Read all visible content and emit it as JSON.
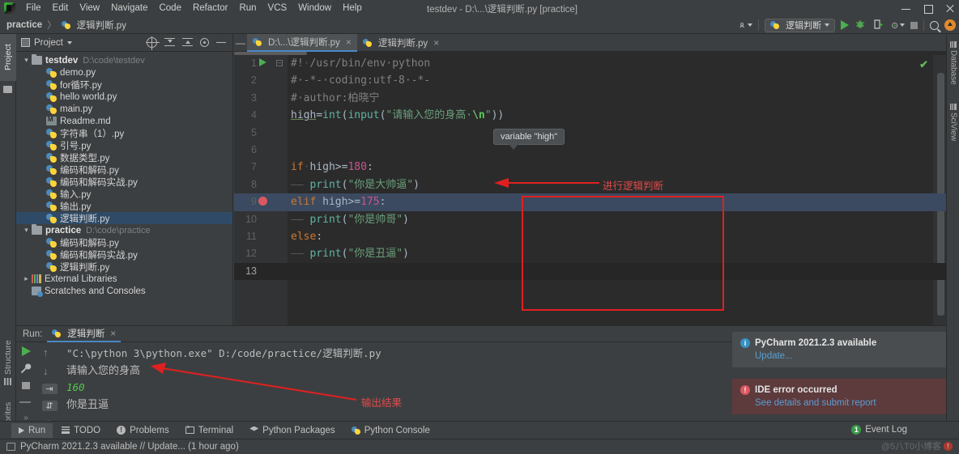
{
  "window": {
    "title": "testdev - D:\\...\\逻辑判断.py [practice]",
    "menus": [
      "File",
      "Edit",
      "View",
      "Navigate",
      "Code",
      "Refactor",
      "Run",
      "VCS",
      "Window",
      "Help"
    ]
  },
  "breadcrumb": {
    "project": "practice",
    "separator": "〉",
    "file": "逻辑判断.py"
  },
  "toolbar": {
    "run_config": "逻辑判断",
    "icons": [
      "profile-icon",
      "run-icon",
      "debug-icon",
      "coverage-icon",
      "profiler-icon",
      "stop-icon",
      "search-icon",
      "update-icon"
    ]
  },
  "left_strip": {
    "tabs": [
      "Project",
      "Structure",
      "Favorites"
    ],
    "selected": "Project"
  },
  "right_strip": {
    "tabs": [
      "Database",
      "SciView"
    ]
  },
  "project_panel": {
    "title": "Project",
    "header_icons": [
      "locate-icon",
      "collapse-all-icon",
      "expand-all-icon",
      "settings-icon",
      "hide-icon"
    ],
    "tree": [
      {
        "indent": 0,
        "arrow": "v",
        "icon": "folder",
        "name": "testdev",
        "bold": true,
        "path": "D:\\code\\testdev",
        "selected": false
      },
      {
        "indent": 1,
        "arrow": "",
        "icon": "python",
        "name": "demo.py",
        "bold": false,
        "path": "",
        "selected": false
      },
      {
        "indent": 1,
        "arrow": "",
        "icon": "python",
        "name": "for循环.py",
        "bold": false,
        "path": "",
        "selected": false
      },
      {
        "indent": 1,
        "arrow": "",
        "icon": "python",
        "name": "hello world.py",
        "bold": false,
        "path": "",
        "selected": false
      },
      {
        "indent": 1,
        "arrow": "",
        "icon": "python",
        "name": "main.py",
        "bold": false,
        "path": "",
        "selected": false
      },
      {
        "indent": 1,
        "arrow": "",
        "icon": "md",
        "name": "Readme.md",
        "bold": false,
        "path": "",
        "selected": false
      },
      {
        "indent": 1,
        "arrow": "",
        "icon": "python",
        "name": "字符串（1）.py",
        "bold": false,
        "path": "",
        "selected": false
      },
      {
        "indent": 1,
        "arrow": "",
        "icon": "python",
        "name": "引号.py",
        "bold": false,
        "path": "",
        "selected": false
      },
      {
        "indent": 1,
        "arrow": "",
        "icon": "python",
        "name": "数据类型.py",
        "bold": false,
        "path": "",
        "selected": false
      },
      {
        "indent": 1,
        "arrow": "",
        "icon": "python",
        "name": "编码和解码.py",
        "bold": false,
        "path": "",
        "selected": false
      },
      {
        "indent": 1,
        "arrow": "",
        "icon": "python",
        "name": "编码和解码实战.py",
        "bold": false,
        "path": "",
        "selected": false
      },
      {
        "indent": 1,
        "arrow": "",
        "icon": "python",
        "name": "输入.py",
        "bold": false,
        "path": "",
        "selected": false
      },
      {
        "indent": 1,
        "arrow": "",
        "icon": "python",
        "name": "输出.py",
        "bold": false,
        "path": "",
        "selected": false
      },
      {
        "indent": 1,
        "arrow": "",
        "icon": "python",
        "name": "逻辑判断.py",
        "bold": false,
        "path": "",
        "selected": true
      },
      {
        "indent": 0,
        "arrow": "v",
        "icon": "folder",
        "name": "practice",
        "bold": true,
        "path": "D:\\code\\practice",
        "selected": false
      },
      {
        "indent": 1,
        "arrow": "",
        "icon": "python",
        "name": "编码和解码.py",
        "bold": false,
        "path": "",
        "selected": false
      },
      {
        "indent": 1,
        "arrow": "",
        "icon": "python",
        "name": "编码和解码实战.py",
        "bold": false,
        "path": "",
        "selected": false
      },
      {
        "indent": 1,
        "arrow": "",
        "icon": "python",
        "name": "逻辑判断.py",
        "bold": false,
        "path": "",
        "selected": false
      },
      {
        "indent": 0,
        "arrow": ">",
        "icon": "lib",
        "name": "External Libraries",
        "bold": false,
        "path": "",
        "selected": false
      },
      {
        "indent": 0,
        "arrow": "",
        "icon": "scratch",
        "name": "Scratches and Consoles",
        "bold": false,
        "path": "",
        "selected": false
      }
    ]
  },
  "editor": {
    "tabs": [
      {
        "label": "D:\\...\\逻辑判断.py",
        "active": true
      },
      {
        "label": "逻辑判断.py",
        "active": false
      }
    ],
    "tooltip": "variable \"high\"",
    "lines": [
      {
        "n": "1",
        "runmark": true,
        "breakpoint": false,
        "current": false,
        "highlight": false
      },
      {
        "n": "2",
        "runmark": false,
        "breakpoint": false,
        "current": false,
        "highlight": false
      },
      {
        "n": "3",
        "runmark": false,
        "breakpoint": false,
        "current": false,
        "highlight": false
      },
      {
        "n": "4",
        "runmark": false,
        "breakpoint": false,
        "current": false,
        "highlight": false
      },
      {
        "n": "5",
        "runmark": false,
        "breakpoint": false,
        "current": false,
        "highlight": false
      },
      {
        "n": "6",
        "runmark": false,
        "breakpoint": false,
        "current": false,
        "highlight": false
      },
      {
        "n": "7",
        "runmark": false,
        "breakpoint": false,
        "current": false,
        "highlight": false
      },
      {
        "n": "8",
        "runmark": false,
        "breakpoint": false,
        "current": false,
        "highlight": false
      },
      {
        "n": "9",
        "runmark": false,
        "breakpoint": true,
        "current": false,
        "highlight": true
      },
      {
        "n": "10",
        "runmark": false,
        "breakpoint": false,
        "current": false,
        "highlight": false
      },
      {
        "n": "11",
        "runmark": false,
        "breakpoint": false,
        "current": false,
        "highlight": false
      },
      {
        "n": "12",
        "runmark": false,
        "breakpoint": false,
        "current": false,
        "highlight": false
      },
      {
        "n": "13",
        "runmark": false,
        "breakpoint": false,
        "current": true,
        "highlight": false
      }
    ],
    "code_text": [
      "#! /usr/bin/env python",
      "# -*- coding:utf-8 -*-",
      "# author:柏晓宁",
      "high=int(input(\"请输入您的身高 \\n\"))",
      "",
      "",
      "if high>=180:",
      "    print(\"你是大帅逼\")",
      "elif high>=175:",
      "    print(\"你是帅哥\")",
      "else:",
      "    print(\"你是丑逼\")",
      ""
    ],
    "annotation_code": "进行逻辑判断",
    "inspection_status": "✔"
  },
  "run_window": {
    "label": "Run:",
    "tab": "逻辑判断",
    "toolbar_icons": [
      "rerun-icon",
      "settings-wrench-icon",
      "stop-icon",
      "trash-icon",
      "scroll-up-icon",
      "scroll-down-icon",
      "soft-wrap-icon",
      "scroll-to-end-icon"
    ],
    "console": [
      {
        "text": "\"C:\\python 3\\python.exe\" D:/code/practice/逻辑判断.py",
        "style": "normal"
      },
      {
        "text": "请输入您的身高 ",
        "style": "cn"
      },
      {
        "text": "160",
        "style": "green"
      },
      {
        "text": "你是丑逼",
        "style": "cn"
      }
    ],
    "annotation_output": "输出结果"
  },
  "notifications": [
    {
      "type": "info",
      "title": "PyCharm 2021.2.3 available",
      "link": "Update..."
    },
    {
      "type": "error",
      "title": "IDE error occurred",
      "link": "See details and submit report"
    }
  ],
  "bottom_tabs": [
    {
      "label": "Run",
      "icon": "run-icon",
      "selected": true
    },
    {
      "label": "TODO",
      "icon": "todo-icon",
      "selected": false
    },
    {
      "label": "Problems",
      "icon": "problems-icon",
      "selected": false
    },
    {
      "label": "Terminal",
      "icon": "terminal-icon",
      "selected": false
    },
    {
      "label": "Python Packages",
      "icon": "packages-icon",
      "selected": false
    },
    {
      "label": "Python Console",
      "icon": "python-console-icon",
      "selected": false
    }
  ],
  "status_bar": {
    "message": "PyCharm 2021.2.3 available // Update... (1 hour ago)",
    "event_log": "Event Log",
    "event_count": "1",
    "watermark": "@5八T0小博客"
  },
  "colors": {
    "accent_blue": "#4a88c7",
    "keyword": "#cc7832",
    "number": "#c7568f",
    "string": "#6a9f7a",
    "comment": "#808080",
    "annotation_red": "#e02020",
    "selection": "#3b4a60"
  }
}
